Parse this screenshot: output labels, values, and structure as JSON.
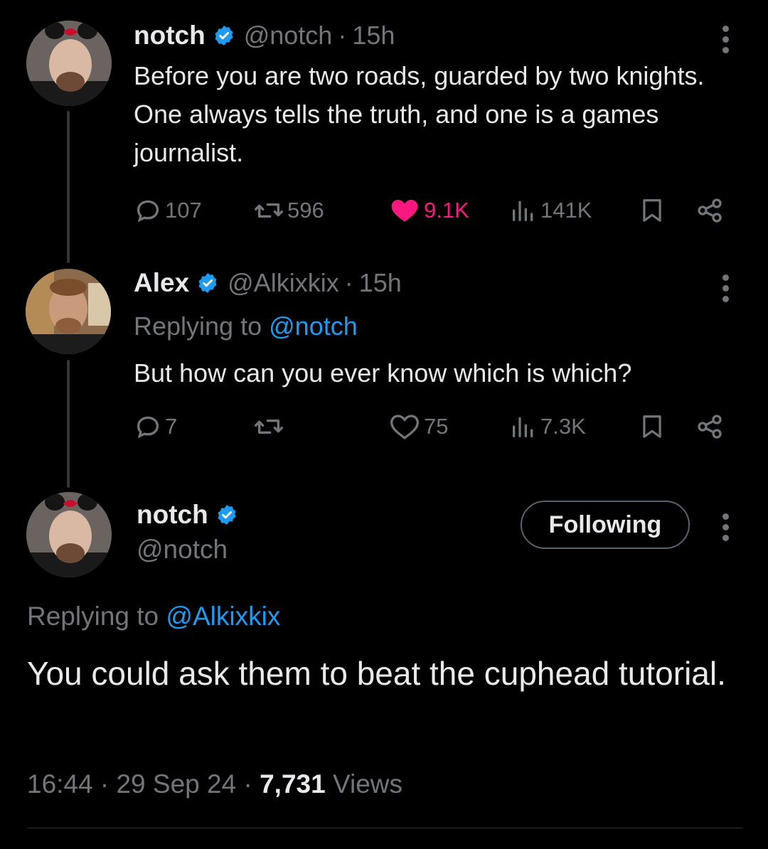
{
  "tweets": [
    {
      "name": "notch",
      "handle": "@notch",
      "sep": "·",
      "time": "15h",
      "text": "Before you are two roads, guarded by two knights. One always tells the truth, and one is a games journalist.",
      "replies": "107",
      "reposts": "596",
      "likes": "9.1K",
      "views": "141K"
    },
    {
      "name": "Alex",
      "handle": "@Alkixkix",
      "sep": "·",
      "time": "15h",
      "replying_label": "Replying to",
      "replying_to": "@notch",
      "text": "But how can you ever know which is which?",
      "replies": "7",
      "reposts": "",
      "likes": "75",
      "views": "7.3K"
    }
  ],
  "main": {
    "name": "notch",
    "handle": "@notch",
    "follow_label": "Following",
    "replying_label": "Replying to",
    "replying_to": "@Alkixkix",
    "text": "You could ask them to beat the cuphead tutorial.",
    "time": "16:44",
    "sep": "·",
    "date": "29 Sep 24",
    "views_count": "7,731",
    "views_label": "Views"
  },
  "colors": {
    "background": "#000000",
    "text": "#e7e9ea",
    "secondary": "#71767b",
    "mention": "#1d9bf0",
    "like": "#f91880",
    "verified": "#1d9bf0"
  }
}
